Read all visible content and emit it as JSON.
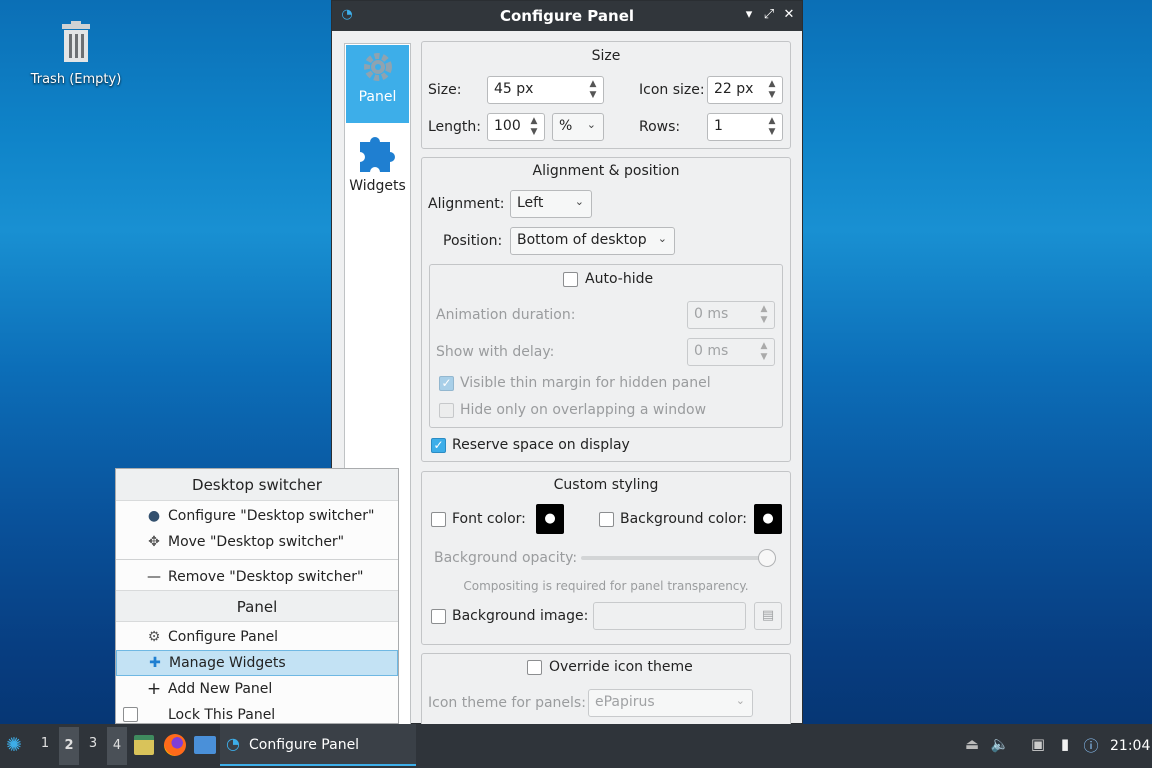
{
  "desktop": {
    "trash_label": "Trash (Empty)"
  },
  "window": {
    "title": "Configure Panel"
  },
  "nav": [
    {
      "label": "Panel",
      "icon": "gear-icon",
      "selected": true
    },
    {
      "label": "Widgets",
      "icon": "puzzle-icon",
      "selected": false
    }
  ],
  "size": {
    "title": "Size",
    "size_label": "Size:",
    "size_value": "45 px",
    "icon_size_label": "Icon size:",
    "icon_size_value": "22 px",
    "length_label": "Length:",
    "length_value": "100",
    "length_unit": "%",
    "rows_label": "Rows:",
    "rows_value": "1"
  },
  "alignment": {
    "title": "Alignment & position",
    "alignment_label": "Alignment:",
    "alignment_value": "Left",
    "position_label": "Position:",
    "position_value": "Bottom of desktop",
    "autohide_label": "Auto-hide",
    "anim_label": "Animation duration:",
    "anim_value": "0 ms",
    "delay_label": "Show with delay:",
    "delay_value": "0 ms",
    "thin_margin_label": "Visible thin margin for hidden panel",
    "overlap_label": "Hide only on overlapping a window",
    "reserve_label": "Reserve space on display"
  },
  "styling": {
    "title": "Custom styling",
    "font_color_label": "Font color:",
    "bg_color_label": "Background color:",
    "opacity_label": "Background opacity:",
    "opacity_value": 1.0,
    "compositing_note": "Compositing is required for panel transparency.",
    "bg_image_label": "Background image:"
  },
  "icons": {
    "override_label": "Override icon theme",
    "theme_label": "Icon theme for panels:",
    "theme_value": "ePapirus"
  },
  "menu": {
    "header1": "Desktop switcher",
    "configure": "Configure \"Desktop switcher\"",
    "move": "Move \"Desktop switcher\"",
    "remove": "Remove \"Desktop switcher\"",
    "header2": "Panel",
    "configure_panel": "Configure Panel",
    "manage_widgets": "Manage Widgets",
    "add_panel": "Add New Panel",
    "lock_panel": "Lock This Panel"
  },
  "taskbar": {
    "workspaces": [
      "1",
      "2",
      "3",
      "4"
    ],
    "task_label": "Configure Panel",
    "clock": "21:04"
  },
  "colors": {
    "accent": "#3daee9",
    "titlebar": "#31363b",
    "taskbar": "#2f343a"
  }
}
